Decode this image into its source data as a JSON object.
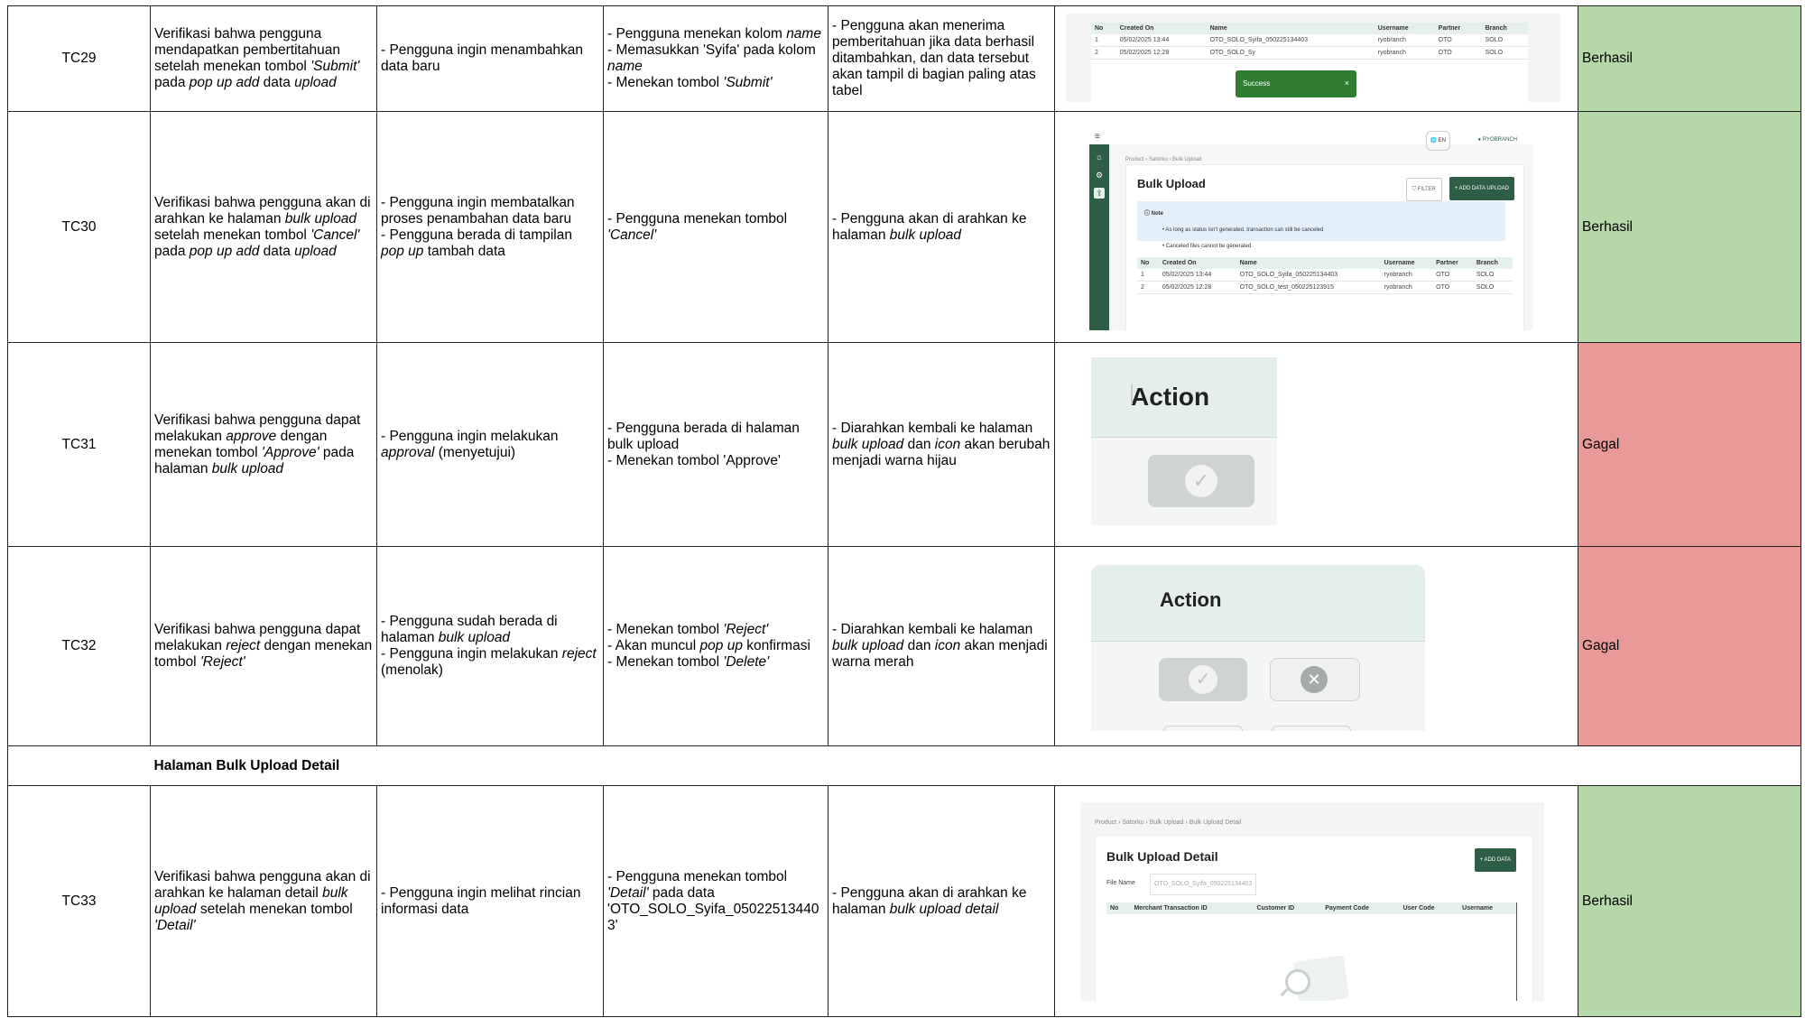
{
  "rows": [
    {
      "id": "TC29",
      "description_parts": [
        {
          "t": "Verifikasi bahwa pengguna mendapatkan pembertitahuan setelah menekan tombol "
        },
        {
          "t": "'Submit'",
          "i": true
        },
        {
          "t": " pada "
        },
        {
          "t": "pop up add",
          "i": true
        },
        {
          "t": " data "
        },
        {
          "t": "upload",
          "i": true
        }
      ],
      "precondition_lines": [
        [
          {
            "t": "- Pengguna ingin menambahkan data baru"
          }
        ]
      ],
      "steps_lines": [
        [
          {
            "t": "- Pengguna menekan kolom "
          },
          {
            "t": "name",
            "i": true
          }
        ],
        [
          {
            "t": "- Memasukkan 'Syifa' pada kolom "
          },
          {
            "t": "name",
            "i": true
          }
        ],
        [
          {
            "t": "- Menekan tombol "
          },
          {
            "t": "'Submit'",
            "i": true
          }
        ]
      ],
      "expected_lines": [
        [
          {
            "t": "- Pengguna akan menerima pemberitahuan jika data berhasil ditambahkan, dan data tersebut akan tampil di bagian paling atas tabel"
          }
        ]
      ],
      "status": "Berhasil",
      "status_color": "#b6d7a8"
    },
    {
      "id": "TC30",
      "description_parts": [
        {
          "t": "Verifikasi bahwa pengguna akan di arahkan ke halaman "
        },
        {
          "t": "bulk upload",
          "i": true
        },
        {
          "t": " setelah menekan tombol "
        },
        {
          "t": "'Cancel'",
          "i": true
        },
        {
          "t": " pada "
        },
        {
          "t": "pop up add",
          "i": true
        },
        {
          "t": " data "
        },
        {
          "t": "upload",
          "i": true
        }
      ],
      "precondition_lines": [
        [
          {
            "t": "- Pengguna ingin membatalkan proses penambahan data baru"
          }
        ],
        [
          {
            "t": "- Pengguna berada di tampilan "
          },
          {
            "t": "pop up",
            "i": true
          },
          {
            "t": " tambah data"
          }
        ]
      ],
      "steps_lines": [
        [
          {
            "t": "-  Pengguna menekan tombol "
          },
          {
            "t": "'Cancel'",
            "i": true
          }
        ]
      ],
      "expected_lines": [
        [
          {
            "t": "- Pengguna akan di arahkan ke halaman "
          },
          {
            "t": "bulk upload",
            "i": true
          }
        ]
      ],
      "status": "Berhasil",
      "status_color": "#b6d7a8"
    },
    {
      "id": "TC31",
      "description_parts": [
        {
          "t": "Verifikasi bahwa pengguna dapat melakukan "
        },
        {
          "t": "approve",
          "i": true
        },
        {
          "t": " dengan menekan tombol "
        },
        {
          "t": "'Approve'",
          "i": true
        },
        {
          "t": " pada halaman "
        },
        {
          "t": "bulk upload",
          "i": true
        }
      ],
      "precondition_lines": [
        [
          {
            "t": "- Pengguna ingin melakukan "
          },
          {
            "t": "approval",
            "i": true
          },
          {
            "t": " (menyetujui)"
          }
        ]
      ],
      "steps_lines": [
        [
          {
            "t": "- Pengguna berada di halaman bulk upload"
          }
        ],
        [
          {
            "t": "- Menekan tombol 'Approve'"
          }
        ]
      ],
      "expected_lines": [
        [
          {
            "t": "- Diarahkan kembali ke halaman "
          },
          {
            "t": "bulk upload",
            "i": true
          },
          {
            "t": " dan "
          },
          {
            "t": "icon",
            "i": true
          },
          {
            "t": " akan berubah menjadi warna hijau"
          }
        ]
      ],
      "status": "Gagal",
      "status_color": "#ea9999"
    },
    {
      "id": "TC32",
      "description_parts": [
        {
          "t": "Verifikasi bahwa pengguna dapat melakukan "
        },
        {
          "t": "reject",
          "i": true
        },
        {
          "t": " dengan menekan tombol "
        },
        {
          "t": "'Reject'",
          "i": true
        }
      ],
      "precondition_lines": [
        [
          {
            "t": "- Pengguna sudah berada di halaman "
          },
          {
            "t": "bulk upload",
            "i": true
          }
        ],
        [
          {
            "t": "- Pengguna ingin melakukan "
          },
          {
            "t": "reject",
            "i": true
          },
          {
            "t": " (menolak)"
          }
        ]
      ],
      "steps_lines": [
        [
          {
            "t": "- Menekan tombol "
          },
          {
            "t": "'Reject'",
            "i": true
          }
        ],
        [
          {
            "t": "- Akan muncul "
          },
          {
            "t": "pop up",
            "i": true
          },
          {
            "t": " konfirmasi"
          }
        ],
        [
          {
            "t": "- Menekan tombol "
          },
          {
            "t": "'Delete'",
            "i": true
          }
        ]
      ],
      "expected_lines": [
        [
          {
            "t": "- Diarahkan kembali ke halaman "
          },
          {
            "t": "bulk upload",
            "i": true
          },
          {
            "t": " dan "
          },
          {
            "t": "icon",
            "i": true
          },
          {
            "t": " akan menjadi warna merah"
          }
        ]
      ],
      "status": "Gagal",
      "status_color": "#ea9999"
    },
    {
      "id": "TC33",
      "description_parts": [
        {
          "t": "Verifikasi bahwa pengguna akan di arahkan ke halaman detail "
        },
        {
          "t": "bulk upload",
          "i": true
        },
        {
          "t": " setelah menekan tombol "
        },
        {
          "t": "'Detail'",
          "i": true
        }
      ],
      "precondition_lines": [
        [
          {
            "t": "- Pengguna ingin melihat rincian informasi data"
          }
        ]
      ],
      "steps_lines": [
        [
          {
            "t": "- Pengguna menekan tombol "
          },
          {
            "t": "'Detail'",
            "i": true
          },
          {
            "t": " pada data 'OTO_SOLO_Syifa_05022513440 3'"
          }
        ]
      ],
      "expected_lines": [
        [
          {
            "t": "- Pengguna akan di arahkan ke halaman "
          },
          {
            "t": "bulk upload detail",
            "i": true
          }
        ]
      ],
      "status": "Berhasil",
      "status_color": "#b6d7a8"
    }
  ],
  "section_title": "Halaman Bulk Upload Detail",
  "screens": {
    "tc29": {
      "headers": [
        "No",
        "Created On",
        "Name",
        "Username",
        "Partner",
        "Branch"
      ],
      "rows": [
        [
          "1",
          "05/02/2025 13:44",
          "OTO_SOLO_Syifa_050225134403",
          "ryobranch",
          "OTO",
          "SOLO"
        ],
        [
          "2",
          "05/02/2025 12:28",
          "OTO_SOLO_Sy",
          "ryobranch",
          "OTO",
          "SOLO"
        ]
      ],
      "toast": "Success",
      "toast_close": "×"
    },
    "tc30": {
      "menu_icon": "≡",
      "lang": "EN",
      "user": "RYOBRANCH",
      "breadcrumb": [
        "Product",
        "Satorku",
        "Bulk Upload"
      ],
      "title": "Bulk Upload",
      "filter_btn": "FILTER",
      "add_btn": "ADD DATA UPLOAD",
      "note_title": "Note",
      "note_lines": [
        "As long as status isn't generated, transaction can still be canceled",
        "Canceled files cannot be generated"
      ],
      "headers": [
        "No",
        "Created On",
        "Name",
        "Username",
        "Partner",
        "Branch"
      ],
      "rows": [
        [
          "1",
          "05/02/2025 13:44",
          "OTO_SOLO_Syifa_050225134403",
          "ryobranch",
          "OTO",
          "SOLO"
        ],
        [
          "2",
          "05/02/2025 12:28",
          "OTO_SOLO_test_050225123915",
          "ryobranch",
          "OTO",
          "SOLO"
        ]
      ]
    },
    "tc31": {
      "header": "Action"
    },
    "tc32": {
      "header": "Action"
    },
    "tc33": {
      "breadcrumb": [
        "Product",
        "Satorku",
        "Bulk Upload",
        "Bulk Upload Detail"
      ],
      "title": "Bulk Upload Detail",
      "add_btn": "ADD DATA",
      "file_label": "File Name",
      "file_value": "OTO_SOLO_Syifa_050225134403",
      "headers": [
        "No",
        "Merchant Transaction ID",
        "Customer ID",
        "Payment Code",
        "User Code",
        "Username"
      ]
    }
  },
  "icons": {
    "check": "check-icon",
    "close": "close-icon",
    "home": "home-icon",
    "settings": "gear-icon",
    "upload": "upload-icon",
    "globe": "globe-icon",
    "user": "user-icon",
    "search": "search-icon"
  }
}
